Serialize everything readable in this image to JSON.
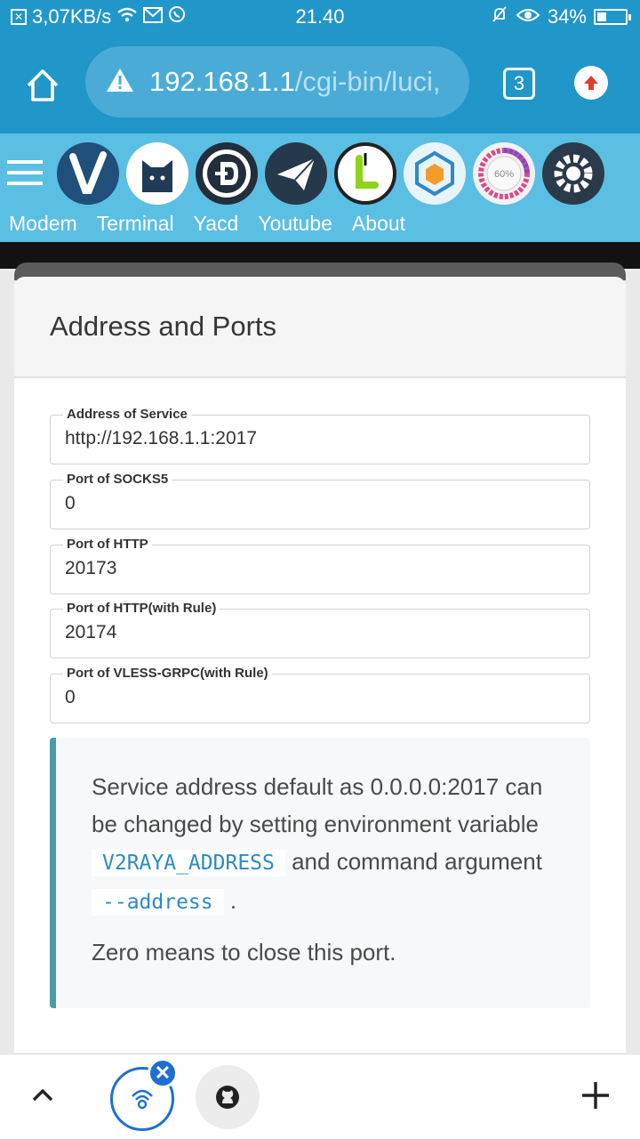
{
  "status_bar": {
    "speed": "3,07KB/s",
    "time": "21.40",
    "battery": "34%",
    "battery_level": 0.34,
    "icons": [
      "screenshot-icon",
      "wifi-icon",
      "gmail-icon",
      "whatsapp-icon",
      "muted-bell-icon",
      "eye-icon",
      "battery-icon"
    ]
  },
  "browser": {
    "url_host": "192.168.1.1",
    "url_path": "/cgi-bin/luci,",
    "tab_count": "3"
  },
  "toolbar": {
    "apps": [
      {
        "name": "v2raya",
        "icon": "v2raya-icon"
      },
      {
        "name": "clash-cat",
        "icon": "cat-icon"
      },
      {
        "name": "dashboard",
        "icon": "d-logo-icon"
      },
      {
        "name": "telegram",
        "icon": "paper-plane-icon"
      },
      {
        "name": "launcher",
        "icon": "l-logo-icon"
      },
      {
        "name": "hexagon-app",
        "icon": "hexagon-icon"
      },
      {
        "name": "speed-gauge",
        "icon": "gauge-icon",
        "text": "60%"
      },
      {
        "name": "settings",
        "icon": "gear-icon"
      }
    ],
    "links": [
      "Modem",
      "Terminal",
      "Yacd",
      "Youtube",
      "About"
    ]
  },
  "card": {
    "title": "Address and Ports",
    "fields": [
      {
        "label": "Address of Service",
        "value": "http://192.168.1.1:2017"
      },
      {
        "label": "Port of SOCKS5",
        "value": "0"
      },
      {
        "label": "Port of HTTP",
        "value": "20173"
      },
      {
        "label": "Port of HTTP(with Rule)",
        "value": "20174"
      },
      {
        "label": "Port of VLESS-GRPC(with Rule)",
        "value": "0"
      }
    ],
    "note": {
      "line1_a": "Service address default as 0.0.0.0:2017 can be changed by setting environment variable ",
      "code1": "V2RAYA_ADDRESS",
      "line1_b": " and command argument ",
      "code2": "--address",
      "line1_c": " .",
      "line2": "Zero means to close this port."
    }
  },
  "colors": {
    "primary": "#2196c9",
    "toolbar": "#5bbfe3",
    "note_border": "#4a9aa8",
    "code_text": "#2b8ac4",
    "badge": "#1f6fd1"
  }
}
